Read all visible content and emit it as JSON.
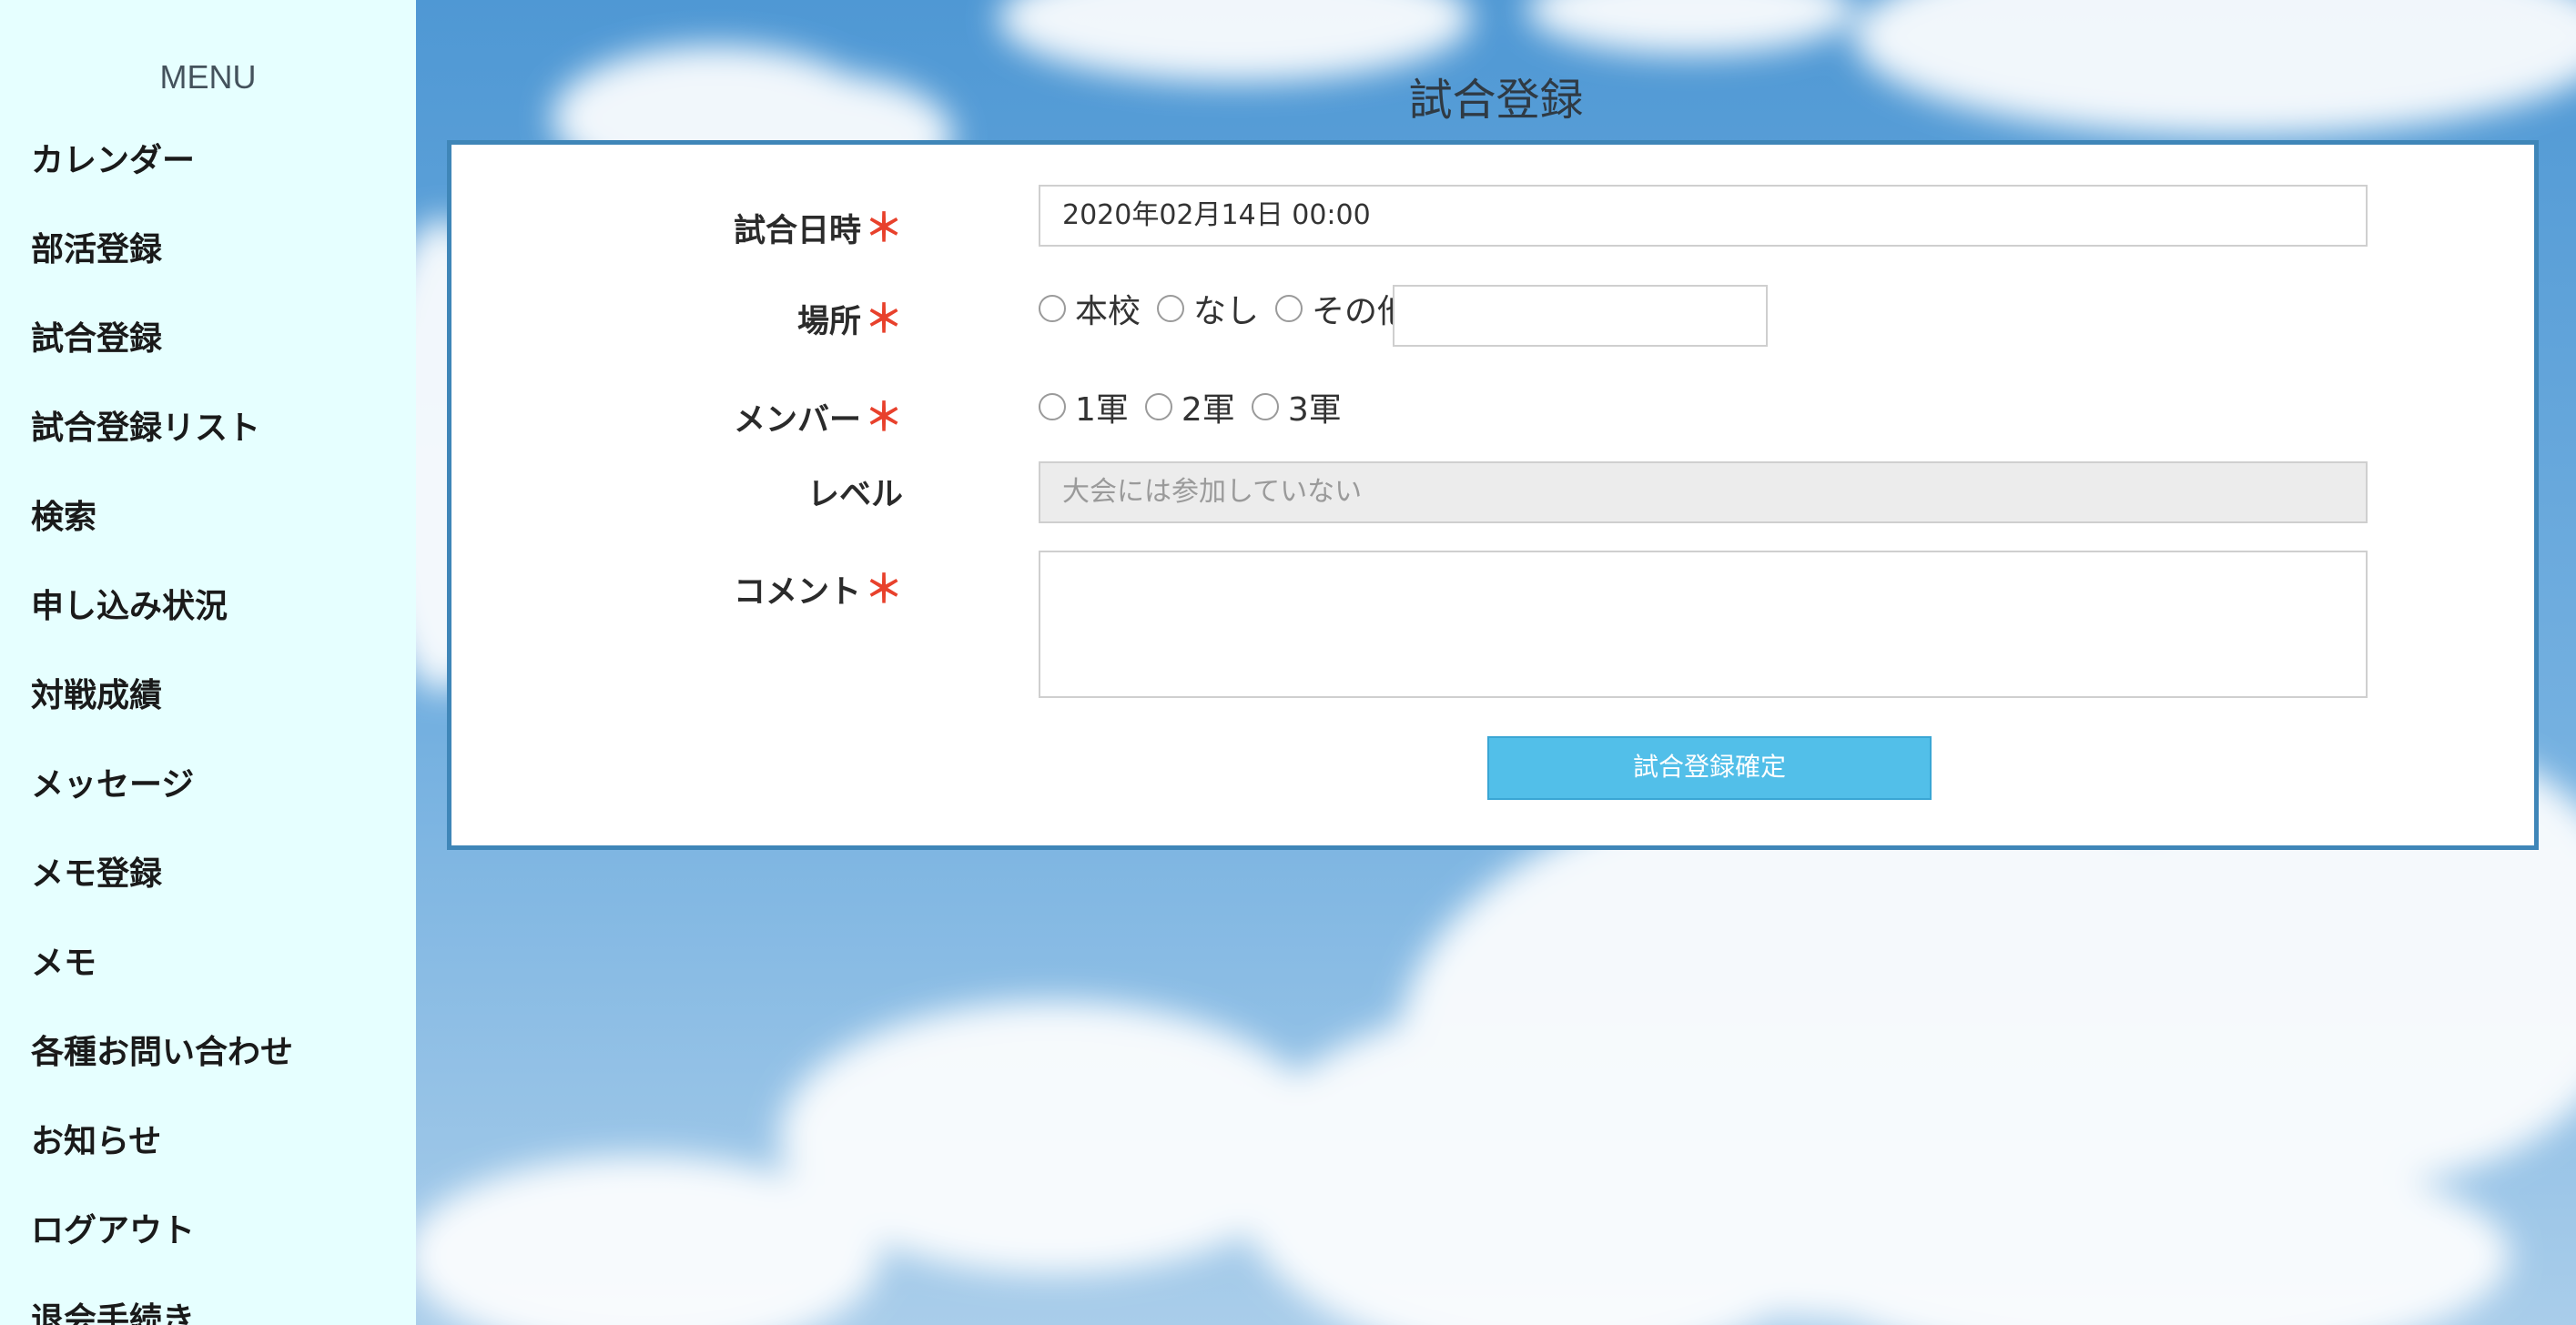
{
  "sidebar": {
    "title": "MENU",
    "items": [
      {
        "label": "カレンダー"
      },
      {
        "label": "部活登録"
      },
      {
        "label": "試合登録"
      },
      {
        "label": "試合登録リスト"
      },
      {
        "label": "検索"
      },
      {
        "label": "申し込み状況"
      },
      {
        "label": "対戦成績"
      },
      {
        "label": "メッセージ"
      },
      {
        "label": "メモ登録"
      },
      {
        "label": "メモ"
      },
      {
        "label": "各種お問い合わせ"
      },
      {
        "label": "お知らせ"
      },
      {
        "label": "ログアウト"
      },
      {
        "label": "退会手続き"
      }
    ]
  },
  "page": {
    "title": "試合登録"
  },
  "form": {
    "required_mark": "＊",
    "datetime": {
      "label": "試合日時",
      "value": "2020年02月14日 00:00"
    },
    "place": {
      "label": "場所",
      "options": [
        "本校",
        "なし",
        "その他"
      ],
      "other_value": ""
    },
    "member": {
      "label": "メンバー",
      "options": [
        "1軍",
        "2軍",
        "3軍"
      ]
    },
    "level": {
      "label": "レベル",
      "placeholder": "大会には参加していない"
    },
    "comment": {
      "label": "コメント",
      "value": ""
    },
    "submit_label": "試合登録確定"
  },
  "colors": {
    "sidebar_bg": "#e6ffff",
    "accent": "#52bfe9",
    "panel_border": "#3f86b8",
    "required": "#e8412c"
  }
}
